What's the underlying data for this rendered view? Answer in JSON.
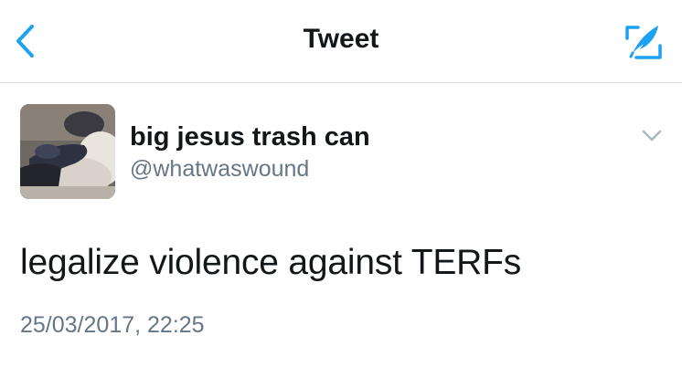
{
  "navbar": {
    "title": "Tweet",
    "back_icon": "chevron-left-icon",
    "compose_icon": "compose-feather-icon",
    "accent_color": "#1da1f2"
  },
  "tweet": {
    "author": {
      "display_name": "big jesus trash can",
      "handle": "@whatwaswound"
    },
    "text": "legalize violence against TERFs",
    "timestamp": "25/03/2017, 22:25",
    "menu_icon": "chevron-down-icon"
  },
  "colors": {
    "primary_text": "#14171a",
    "secondary_text": "#657786",
    "divider": "#d6d9dc"
  }
}
